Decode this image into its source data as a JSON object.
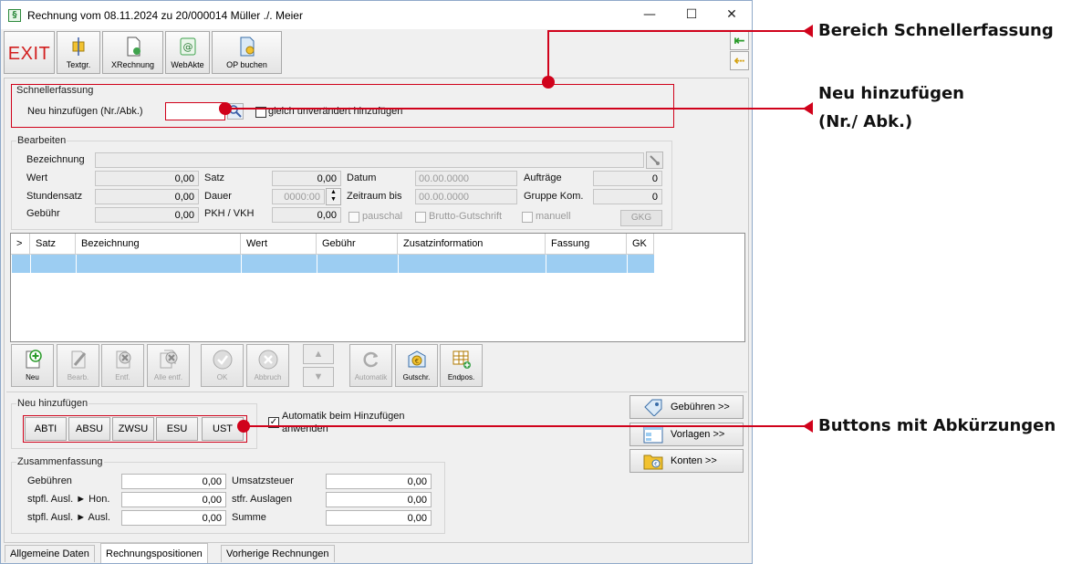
{
  "window": {
    "title": "Rechnung vom 08.11.2024 zu 20/000014  Müller ./. Meier",
    "app_icon_glyph": "§",
    "min_glyph": "—",
    "max_glyph": "☐",
    "close_glyph": "✕"
  },
  "toolbar": {
    "exit": "EXIT",
    "textgr": "Textgr.",
    "xrechnung": "XRechnung",
    "webakte": "WebAkte",
    "op_buchen": "OP buchen",
    "nav_first": "⇤",
    "nav_prev": "⇠"
  },
  "schnellerfassung": {
    "title": "Schnellerfassung",
    "neu_label": "Neu hinzufügen (Nr./Abk.)",
    "input_value": "",
    "checkbox_label": "gleich unverändert hinzufügen"
  },
  "bearbeiten": {
    "title": "Bearbeiten",
    "bezeichnung_label": "Bezeichnung",
    "bezeichnung_value": "",
    "wert_label": "Wert",
    "wert_value": "0,00",
    "stundensatz_label": "Stundensatz",
    "stundensatz_value": "0,00",
    "gebuehr_label": "Gebühr",
    "gebuehr_value": "0,00",
    "satz_label": "Satz",
    "satz_value": "0,00",
    "dauer_label": "Dauer",
    "dauer_value": "0000:00",
    "pkh_label": "PKH / VKH",
    "pkh_value": "0,00",
    "datum_label": "Datum",
    "datum_value": "00.00.0000",
    "zeitraum_label": "Zeitraum bis",
    "zeitraum_value": "00.00.0000",
    "pauschal_label": "pauschal",
    "brutto_label": "Brutto-Gutschrift",
    "auftraege_label": "Aufträge",
    "auftraege_value": "0",
    "gruppe_label": "Gruppe Kom.",
    "gruppe_value": "0",
    "manuell_label": "manuell",
    "gkg_button": "GKG"
  },
  "grid": {
    "columns": [
      ">",
      "Satz",
      "Bezeichnung",
      "Wert",
      "Gebühr",
      "Zusatzinformation",
      "Fassung",
      "GK"
    ]
  },
  "actions": {
    "neu": "Neu",
    "bearb": "Bearb.",
    "entf": "Entf.",
    "alle_entf": "Alle entf.",
    "ok": "OK",
    "abbruch": "Abbruch",
    "automatik": "Automatik",
    "gutschr": "Gutschr.",
    "endpos": "Endpos."
  },
  "neu_hinzufuegen": {
    "title": "Neu hinzufügen",
    "buttons": [
      "ABTI",
      "ABSU",
      "ZWSU",
      "ESU",
      "UST"
    ],
    "automatik_label_line1": "Automatik beim Hinzufügen",
    "automatik_label_line2": "anwenden",
    "automatik_checked": true
  },
  "side_buttons": {
    "gebuehren": "Gebühren >>",
    "vorlagen": "Vorlagen >>",
    "konten": "Konten >>"
  },
  "zusammenfassung": {
    "title": "Zusammenfassung",
    "gebuehren_label": "Gebühren",
    "gebuehren_value": "0,00",
    "stpfl_hon_label": "stpfl. Ausl. ► Hon.",
    "stpfl_hon_value": "0,00",
    "stpfl_ausl_label": "stpfl. Ausl. ► Ausl.",
    "stpfl_ausl_value": "0,00",
    "ust_label": "Umsatzsteuer",
    "ust_value": "0,00",
    "stfr_label": "stfr. Auslagen",
    "stfr_value": "0,00",
    "summe_label": "Summe",
    "summe_value": "0,00"
  },
  "tabs": [
    "Allgemeine Daten",
    "Rechnungspositionen",
    "Vorherige Rechnungen"
  ],
  "annotations": {
    "bereich": "Bereich Schnellerfassung",
    "neu_line1": "Neu hinzufügen",
    "neu_line2": "(Nr./ Abk.)",
    "buttons": "Buttons mit Abkürzungen"
  },
  "colors": {
    "accent_red": "#d0021b",
    "selection_blue": "#9ccdf2",
    "exit_red": "#d21f1f"
  }
}
